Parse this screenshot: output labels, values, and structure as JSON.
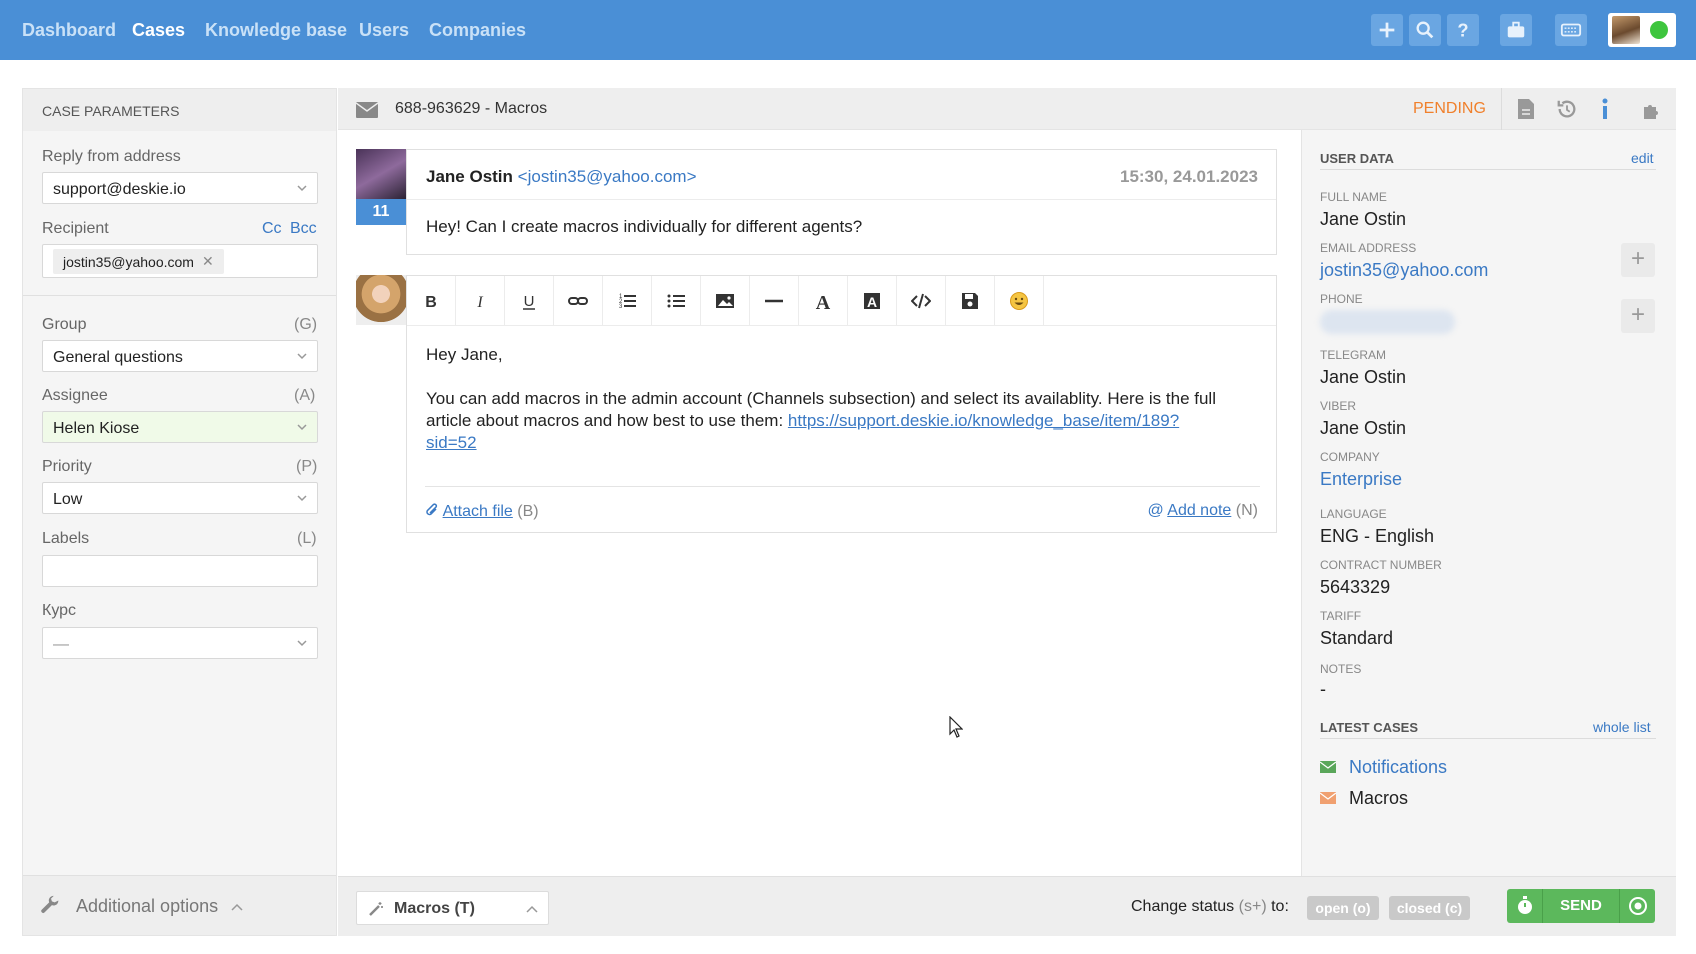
{
  "nav": {
    "dashboard": "Dashboard",
    "cases": "Cases",
    "knowledge_base": "Knowledge base",
    "users": "Users",
    "companies": "Companies"
  },
  "case_params": {
    "title": "CASE PARAMETERS",
    "reply_from_label": "Reply from address",
    "reply_from_value": "support@deskie.io",
    "recipient_label": "Recipient",
    "cc": "Cc",
    "bcc": "Bcc",
    "recipient_value": "jostin35@yahoo.com",
    "group_label": "Group",
    "group_hint": "(G)",
    "group_value": "General questions",
    "assignee_label": "Assignee",
    "assignee_hint": "(A)",
    "assignee_value": "Helen Kiose",
    "priority_label": "Priority",
    "priority_hint": "(P)",
    "priority_value": "Low",
    "labels_label": "Labels",
    "labels_hint": "(L)",
    "kyrs_label": "Курс",
    "kyrs_value": "—",
    "additional_options": "Additional options"
  },
  "case": {
    "title": "688-963629 - Macros",
    "status": "PENDING"
  },
  "message": {
    "author_name": "Jane Ostin",
    "author_email": "<jostin35@yahoo.com>",
    "date": "15:30, 24.01.2023",
    "badge": "11",
    "body": "Hey! Can I create macros individually for different agents?"
  },
  "reply": {
    "greeting": "Hey Jane,",
    "body_text": "You can add macros in the admin account (Channels subsection) and select its availablity. Here is the full article about macros and how best to use them: ",
    "link_part1": "https://support.deskie.io/knowledge_base/item/189?",
    "link_part2": "sid=52",
    "attach_file": "Attach file",
    "attach_hint": "(B)",
    "add_note": "Add note",
    "note_hint": "(N)"
  },
  "toolbar_icons": [
    "bold-icon",
    "italic-icon",
    "underline-icon",
    "link-icon",
    "ordered-list-icon",
    "bullet-list-icon",
    "image-icon",
    "horizontal-rule-icon",
    "text-color-icon",
    "background-color-icon",
    "code-icon",
    "save-icon",
    "emoji-icon"
  ],
  "user_data": {
    "title": "USER DATA",
    "edit": "edit",
    "full_name_label": "FULL NAME",
    "full_name": "Jane Ostin",
    "email_label": "EMAIL ADDRESS",
    "email": "jostin35@yahoo.com",
    "phone_label": "PHONE",
    "telegram_label": "TELEGRAM",
    "telegram": "Jane Ostin",
    "viber_label": "VIBER",
    "viber": "Jane Ostin",
    "company_label": "COMPANY",
    "company": "Enterprise",
    "language_label": "LANGUAGE",
    "language": "ENG - English",
    "contract_label": "CONTRACT NUMBER",
    "contract": "5643329",
    "tariff_label": "TARIFF",
    "tariff": "Standard",
    "notes_label": "NOTES",
    "notes": "-"
  },
  "latest_cases": {
    "title": "LATEST CASES",
    "whole_list": "whole list",
    "items": [
      {
        "label": "Notifications",
        "color": "#5aa65a"
      },
      {
        "label": "Macros",
        "color": "#f0a070"
      }
    ]
  },
  "footer": {
    "macros": "Macros (T)",
    "change_status_prefix": "Change status",
    "change_status_hint": "(s+)",
    "change_status_suffix": "to:",
    "open": "open (o)",
    "closed": "closed (c)",
    "send": "SEND"
  },
  "colors": {
    "brand": "#4a8fd6",
    "send": "#5cb85c",
    "pending": "#f0802c"
  }
}
